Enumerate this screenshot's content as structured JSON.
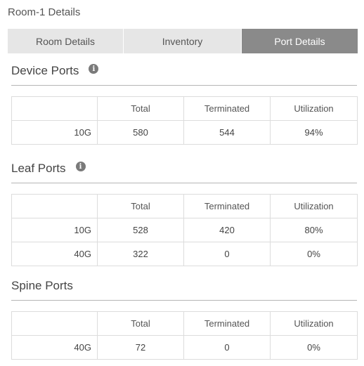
{
  "page_title": "Room-1 Details",
  "tabs": [
    {
      "label": "Room Details",
      "active": false
    },
    {
      "label": "Inventory",
      "active": false
    },
    {
      "label": "Port Details",
      "active": true
    }
  ],
  "columns": [
    "",
    "Total",
    "Terminated",
    "Utilization"
  ],
  "sections": {
    "device": {
      "title": "Device Ports",
      "rows": [
        {
          "speed": "10G",
          "total": "580",
          "terminated": "544",
          "utilization": "94%"
        }
      ]
    },
    "leaf": {
      "title": "Leaf Ports",
      "rows": [
        {
          "speed": "10G",
          "total": "528",
          "terminated": "420",
          "utilization": "80%"
        },
        {
          "speed": "40G",
          "total": "322",
          "terminated": "0",
          "utilization": "0%"
        }
      ]
    },
    "spine": {
      "title": "Spine Ports",
      "rows": [
        {
          "speed": "40G",
          "total": "72",
          "terminated": "0",
          "utilization": "0%"
        }
      ]
    }
  },
  "icons": {
    "info": "info-icon"
  },
  "colors": {
    "active_tab_bg": "#8a8a8a",
    "tab_bg": "#e6e6e6"
  }
}
